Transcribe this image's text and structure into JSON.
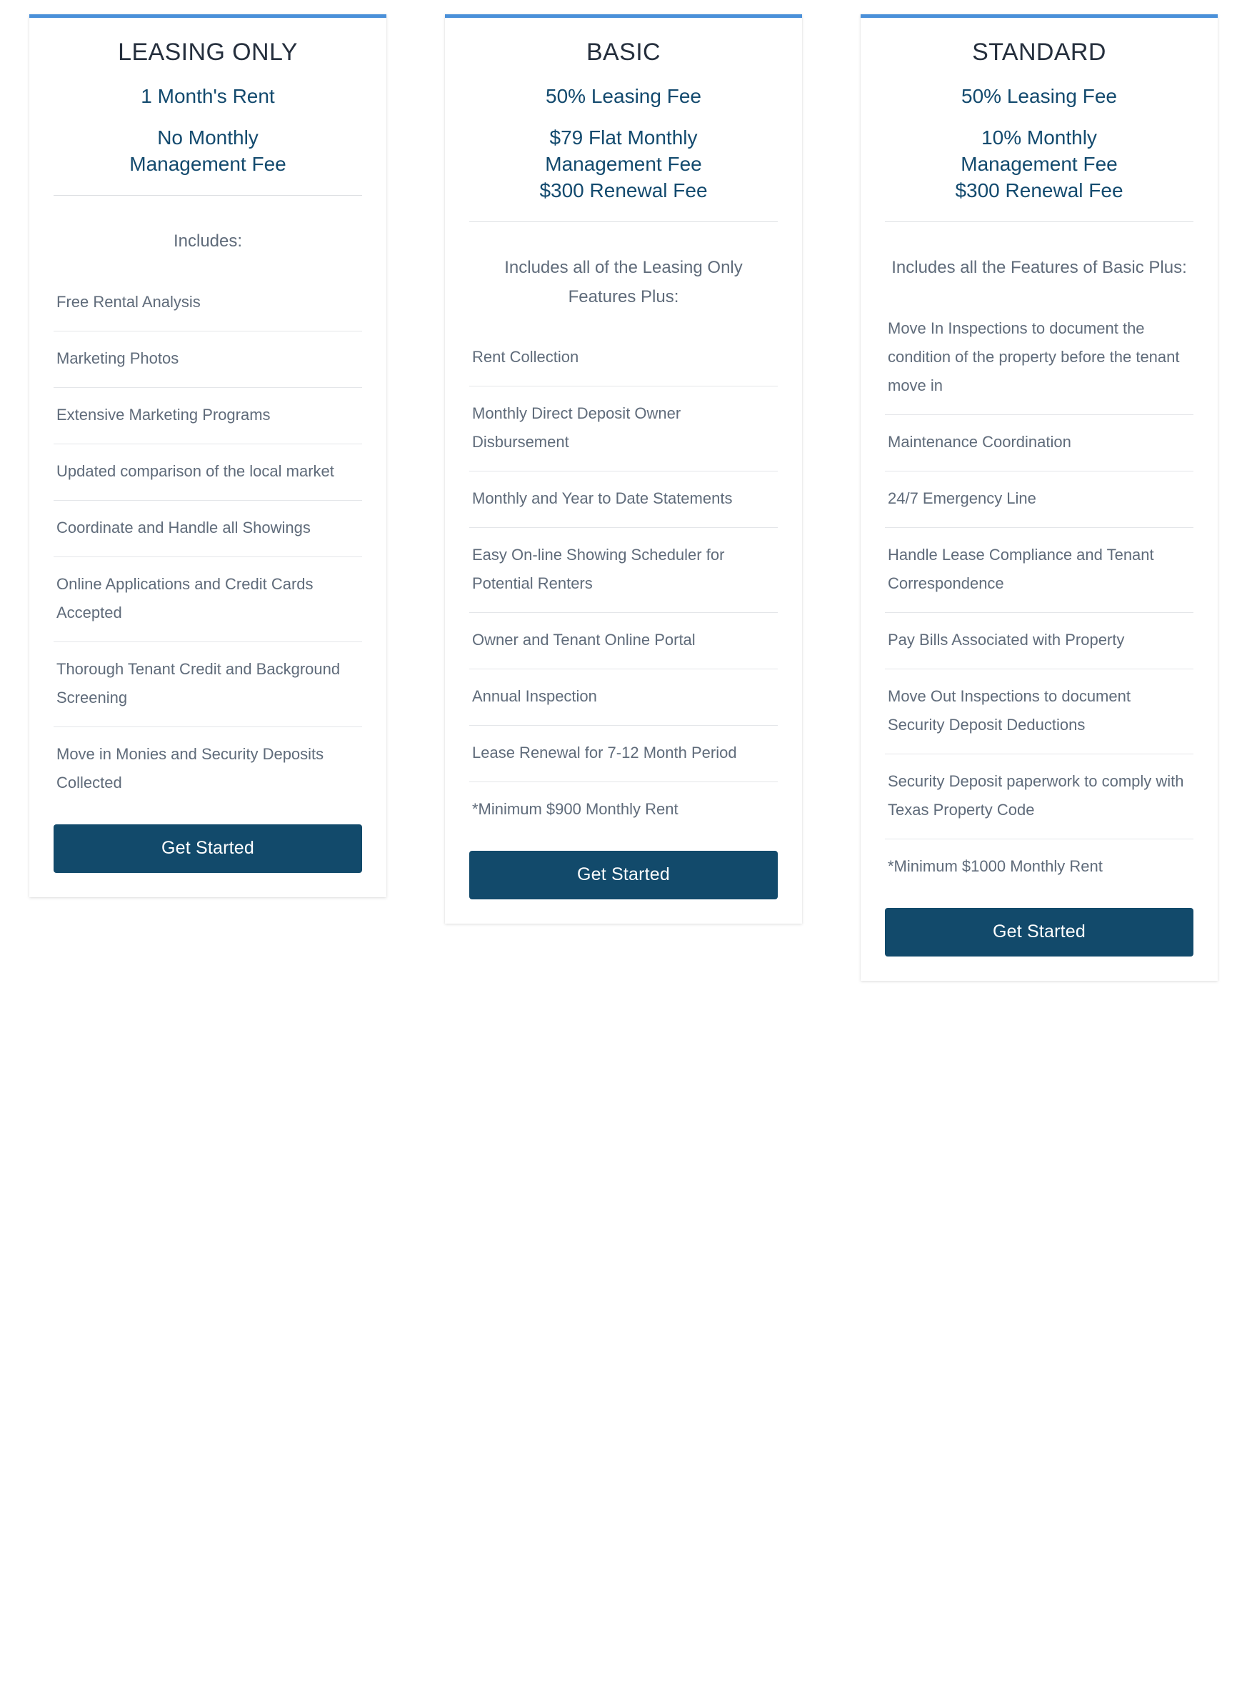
{
  "theme": {
    "accent_bar": "#4a90d9",
    "title_color": "#252f3d",
    "price_color": "#134a6e",
    "body_color": "#5f6b7a",
    "button_bg": "#124a6b",
    "button_text": "#ffffff",
    "divider": "#e4e6e9",
    "card_bg": "#ffffff"
  },
  "plans": [
    {
      "name": "LEASING ONLY",
      "price_lines": [
        "1 Month's Rent"
      ],
      "price_block": [
        "No Monthly",
        "Management Fee"
      ],
      "includes_header": "Includes:",
      "features": [
        "Free Rental Analysis",
        "Marketing Photos",
        "Extensive Marketing Programs",
        "Updated comparison of the local market",
        "Coordinate and Handle all Showings",
        "Online Applications and Credit Cards Accepted",
        "Thorough Tenant Credit and Background Screening",
        "Move in Monies and Security Deposits Collected"
      ],
      "cta_label": "Get Started"
    },
    {
      "name": "BASIC",
      "price_lines": [
        "50% Leasing Fee"
      ],
      "price_block": [
        "$79 Flat Monthly",
        "Management Fee",
        "$300 Renewal Fee"
      ],
      "includes_header": "Includes all of the Leasing Only Features Plus:",
      "features": [
        "Rent Collection",
        "Monthly Direct Deposit Owner Disbursement",
        "Monthly and Year to Date Statements",
        "Easy On-line Showing Scheduler for Potential Renters",
        "Owner and Tenant Online Portal",
        "Annual Inspection",
        "Lease Renewal for 7-12 Month Period",
        "*Minimum $900 Monthly Rent"
      ],
      "cta_label": "Get Started"
    },
    {
      "name": "STANDARD",
      "price_lines": [
        "50% Leasing Fee"
      ],
      "price_block": [
        "10% Monthly",
        "Management Fee",
        "$300 Renewal Fee"
      ],
      "includes_header": "Includes all the Features of Basic Plus:",
      "features": [
        "Move In Inspections to document the condition of the property before the tenant move in",
        "Maintenance Coordination",
        "24/7 Emergency Line",
        "Handle Lease Compliance and Tenant Correspondence",
        "Pay Bills Associated with Property",
        "Move Out Inspections to document Security Deposit Deductions",
        "Security Deposit paperwork to comply with Texas Property Code",
        "*Minimum $1000 Monthly Rent"
      ],
      "cta_label": "Get Started"
    }
  ]
}
